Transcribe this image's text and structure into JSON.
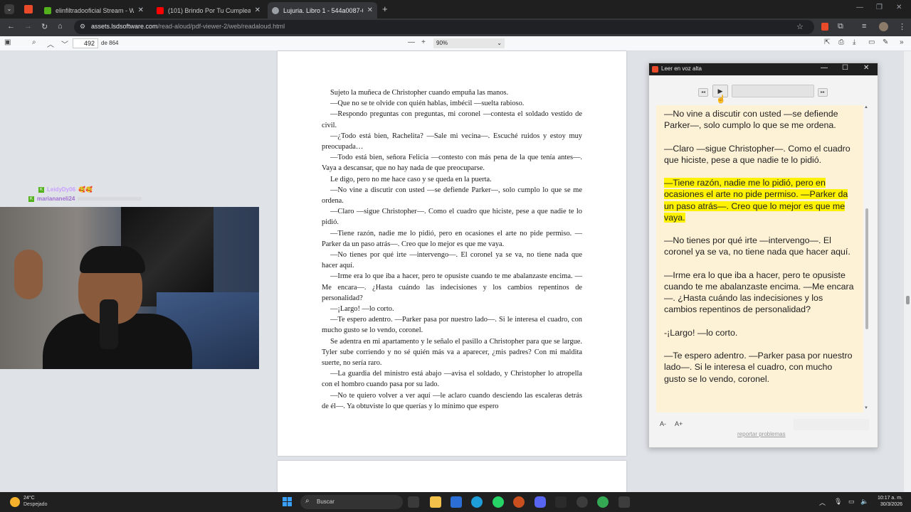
{
  "browser": {
    "tabs": [
      {
        "label": "elinfiltradooficial Stream - Watc",
        "color": "#53b21c"
      },
      {
        "label": "(101) Brindo Por Tu Cumpleaño",
        "color": "#ff0000"
      },
      {
        "label": "Lujuria. Libro 1 - 544a0087-06",
        "color": "#9aa0a6"
      }
    ],
    "url_host": "assets.lsdsoftware.com",
    "url_path": "/read-aloud/pdf-viewer-2/web/readaloud.html"
  },
  "pdf_toolbar": {
    "page_number": "492",
    "page_total": "de 864",
    "zoom": "90%"
  },
  "pdf_page": {
    "paragraphs": [
      "Sujeto la muñeca de Christopher cuando empuña las manos.",
      "—Que no se te olvide con quién hablas, imbécil —suelta rabioso.",
      "—Respondo preguntas con preguntas, mi coronel —contesta el soldado vestido de civil.",
      "—¿Todo está bien, Rachelita? —Sale mi vecina—. Escuché ruidos y estoy muy preocupada…",
      "—Todo está bien, señora Felicia —contesto con más pena de la que tenía antes—. Vaya a descansar, que no hay nada de que preocuparse.",
      "Le digo, pero no me hace caso y se queda en la puerta.",
      "—No vine a discutir con usted —se defiende Parker—, solo cumplo lo que se me ordena.",
      "—Claro —sigue Christopher—. Como el cuadro que hiciste, pese a que nadie te lo pidió.",
      "—Tiene razón, nadie me lo pidió, pero en ocasiones el arte no pide permiso. —Parker da un paso atrás—. Creo que lo mejor es que me vaya.",
      "—No tienes por qué irte —intervengo—. El coronel ya se va, no tiene nada que hacer aquí.",
      "—Irme era lo que iba a hacer, pero te opusiste cuando te me abalanzaste encima. —Me encara—. ¿Hasta cuándo las indecisiones y los cambios repentinos de personalidad?",
      "—¡Largo! —lo corto.",
      "—Te espero adentro. —Parker pasa por nuestro lado—. Si le interesa el cuadro, con mucho gusto se lo vendo, coronel.",
      "Se adentra en mi apartamento y le señalo el pasillo a Christopher para que se largue. Tyler sube corriendo y no sé quién más va a aparecer, ¿mis padres? Con mi maldita suerte, no sería raro.",
      "—La guardia del ministro está abajo —avisa el soldado, y Christopher lo atropella con el hombro cuando pasa por su lado.",
      "—No te quiero volver a ver aquí —le aclaro cuando desciendo las escaleras detrás de él—. Ya obtuviste lo que querías y lo mínimo que espero"
    ]
  },
  "stream_overlay": {
    "chat": [
      {
        "user": "LeidyDy06",
        "text": "🥰🥰",
        "color": "#c9a0ff"
      },
      {
        "user": "mariananeli24",
        "text": "",
        "color": "#a070d0"
      }
    ]
  },
  "read_aloud": {
    "title": "Leer en voz alta",
    "paragraphs": [
      {
        "text": "—No vine a discutir con usted —se defiende Parker—, solo cumplo lo que se me ordena.",
        "highlight": false
      },
      {
        "text": "—Claro —sigue Christopher—. Como el cuadro que hiciste, pese a que nadie te lo pidió.",
        "highlight": false
      },
      {
        "text": "—Tiene razón, nadie me lo pidió, pero en ocasiones el arte no pide permiso. —Parker da un paso atrás—. Creo que lo mejor es que me vaya.",
        "highlight": true
      },
      {
        "text": "—No tienes por qué irte —intervengo—. El coronel ya se va, no tiene nada que hacer aquí.",
        "highlight": false
      },
      {
        "text": "—Irme era lo que iba a hacer, pero te opusiste cuando te me abalanzaste encima. —Me encara—. ¿Hasta cuándo las indecisiones y los cambios repentinos de personalidad?",
        "highlight": false
      },
      {
        "text": "-¡Largo! —lo corto.",
        "highlight": false
      },
      {
        "text": "—Te espero adentro. —Parker pasa por nuestro lado—. Si le interesa el cuadro, con mucho gusto se lo vendo, coronel.",
        "highlight": false
      }
    ],
    "font_smaller": "A-",
    "font_larger": "A+",
    "report_link": "reportar problemas",
    "highlight_color": "#fff200"
  },
  "taskbar": {
    "temperature": "24°C",
    "weather": "Despejado",
    "search_placeholder": "Buscar",
    "time": "10:17 a. m.",
    "date": "30/3/2026"
  }
}
